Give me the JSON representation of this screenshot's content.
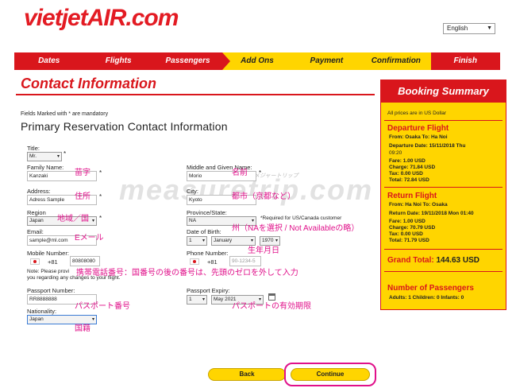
{
  "header": {
    "logo_main": "vietjet",
    "logo_air": "AIR",
    "logo_domain": ".com",
    "language": "English"
  },
  "steps": [
    {
      "label": "Dates",
      "state": "done"
    },
    {
      "label": "Flights",
      "state": "done"
    },
    {
      "label": "Passengers",
      "state": "current"
    },
    {
      "label": "Add Ons",
      "state": "todo"
    },
    {
      "label": "Payment",
      "state": "todo"
    },
    {
      "label": "Confirmation",
      "state": "todo"
    },
    {
      "label": "Finish",
      "state": "done"
    }
  ],
  "page": {
    "title": "Contact Information",
    "mandatory_note": "Fields Marked with * are mandatory",
    "section_title": "Primary Reservation Contact Information"
  },
  "form": {
    "title_label": "Title:",
    "title_value": "Mr.",
    "family_label": "Family Name:",
    "family_value": "Kanzaki",
    "middle_label": "Middle and Given Name:",
    "middle_value": "Morio",
    "address_label": "Address:",
    "address_value": "Adress Sample",
    "city_label": "City:",
    "city_value": "Kyoto",
    "region_label": "Region",
    "region_value": "Japan",
    "province_label": "Province/State:",
    "province_value": "NA",
    "province_note": "*Required for US/Canada customer",
    "email_label": "Email:",
    "email_value": "sample@ml.com",
    "dob_label": "Date of Birth:",
    "dob_day": "1",
    "dob_month": "January",
    "dob_year": "1970",
    "mobile_label": "Mobile Number:",
    "mobile_code": "+81",
    "mobile_value": "80808080",
    "phone_label": "Phone Number:",
    "phone_code": "+81",
    "phone_placeholder": "90-1234-5",
    "mobile_note_1": "Note: Please provi",
    "mobile_note_2": "you regarding any changes to your flight.",
    "passport_label": "Passport Number:",
    "passport_value": "RR8888888",
    "expiry_label": "Passport Expiry:",
    "expiry_day": "1",
    "expiry_month": "May 2021",
    "nationality_label": "Nationality:",
    "nationality_value": "Japan"
  },
  "annotations": {
    "family": "苗字",
    "middle": "名前",
    "address": "住所",
    "city": "都市（京都など）",
    "region": "地域／国",
    "email": "Eメール",
    "province": "州（NAを選択 / Not Availableの略）",
    "dob": "生年月日",
    "mobile": "携帯電話番号：国番号の後の番号は、先頭のゼロを外して入力",
    "passport": "パスポート番号",
    "expiry": "パスポートの有効期限",
    "nationality": "国籍"
  },
  "watermark": {
    "main": "measuretrip.com",
    "sub": "メジャートリップ"
  },
  "summary": {
    "title": "Booking Summary",
    "currency_note": "All prices are in US Dollar",
    "departure_title": "Departure Flight",
    "dep_route": "From: Osaka   To: Ha Noi",
    "dep_date_1": "Departure Date: 15/11/2018 Thu",
    "dep_date_2": "09:20",
    "dep_fare": "Fare: 1.00 USD",
    "dep_charge": "Charge: 71.84 USD",
    "dep_tax": "Tax: 0.00 USD",
    "dep_total": "Total: 72.84 USD",
    "return_title": "Return Flight",
    "ret_route": "From: Ha Noi   To: Osaka",
    "ret_date": "Return Date: 19/11/2018 Mon 01:40",
    "ret_fare": "Fare: 1.00 USD",
    "ret_charge": "Charge: 70.79 USD",
    "ret_tax": "Tax: 0.00 USD",
    "ret_total": "Total: 71.79 USD",
    "grand_total_label": "Grand Total:",
    "grand_total_value": "144.63 USD",
    "passengers_title": "Number of Passengers",
    "passengers": "Adults: 1   Children: 0   Infants: 0"
  },
  "buttons": {
    "back": "Back",
    "continue": "Continue"
  },
  "colors": {
    "brand_red": "#d9161c",
    "brand_yellow": "#ffd500",
    "annotation_pink": "#e0108a"
  }
}
